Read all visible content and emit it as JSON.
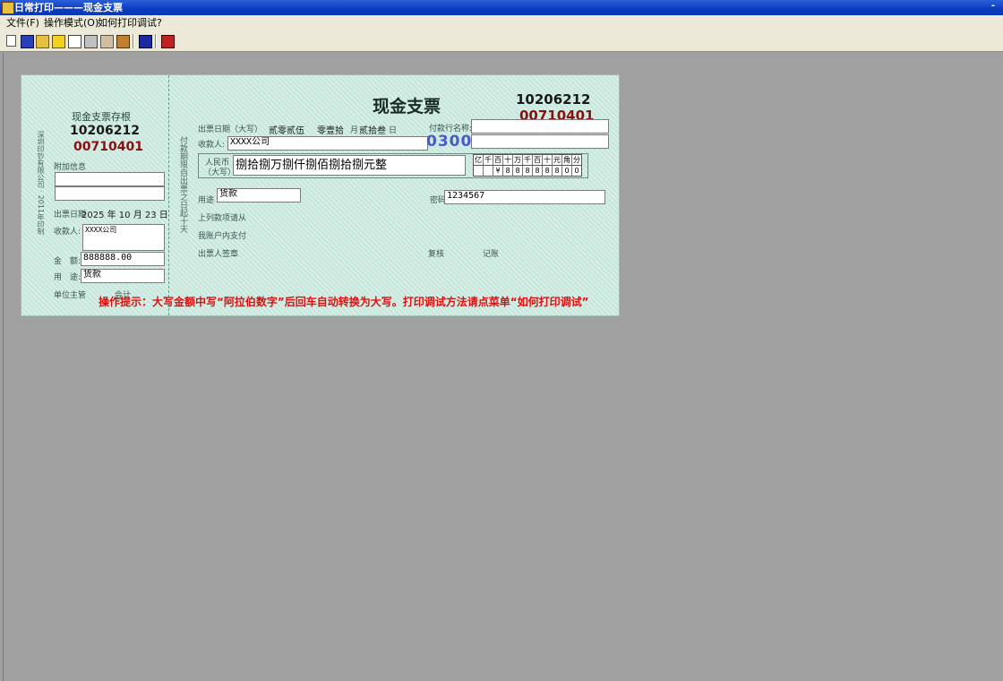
{
  "window": {
    "title": "日常打印———现金支票",
    "minimize": "-"
  },
  "menu": [
    "文件(F)",
    "操作模式(O)",
    "如何打印调试?"
  ],
  "toolbar": {
    "icons": [
      "new-doc-icon",
      "save-icon",
      "open-folder-icon",
      "check-icon",
      "print-preview-icon",
      "printer-icon",
      "print-setup-icon",
      "tools-icon",
      "book-icon",
      "help-icon"
    ]
  },
  "stub": {
    "title": "现金支票存根",
    "code1": "10206212",
    "code2": "00710401",
    "attach_label": "附加信息",
    "attach_1": "",
    "attach_2": "",
    "vertical_note": "深圳印钞有限公司 · 2011年印制",
    "date_label": "出票日期",
    "date_value": "2025 年 10 月 23 日",
    "payee_label": "收款人:",
    "payee_value": "XXXX公司",
    "amount_label": "金　额:",
    "amount_value": "888888.00",
    "use_label": "用　途:",
    "use_value": "货款",
    "manager_label": "单位主管",
    "accounting_label": "会计"
  },
  "cheque": {
    "title": "现金支票",
    "code1": "10206212",
    "code2": "00710401",
    "vertical_note": "付款期限自出票之日起十天",
    "date_label": "出票日期（大写）",
    "date_year": "贰零贰伍",
    "date_month": "零壹拾",
    "date_month_unit": "月",
    "date_day": "贰拾叁",
    "date_day_unit": "日",
    "payer_bank_label": "付款行名称:",
    "payer_bank_value": "",
    "payee_label": "收款人:",
    "payee_value": "XXXX公司",
    "account_value": "",
    "stamp_code": "0300",
    "rmb_label_1": "人民币",
    "rmb_label_2": "（大写）",
    "amount_words": "捌拾捌万捌仟捌佰捌拾捌元整",
    "digit_headers": [
      "亿",
      "千",
      "百",
      "十",
      "万",
      "千",
      "百",
      "十",
      "元",
      "角",
      "分"
    ],
    "digit_values": [
      "",
      "",
      "¥",
      "8",
      "8",
      "8",
      "8",
      "8",
      "8",
      "0",
      "0"
    ],
    "use_label": "用途",
    "use_value": "货款",
    "password_label": "密码",
    "password_value": "1234567",
    "line1": "上列款项请从",
    "line2": "我账户内支付",
    "signer_label": "出票人签章",
    "review_label": "复核",
    "record_label": "记账"
  },
  "hint": "操作提示：大写金额中写“阿拉伯数字”后回车自动转换为大写。打印调试方法请点菜单“如何打印调试”"
}
